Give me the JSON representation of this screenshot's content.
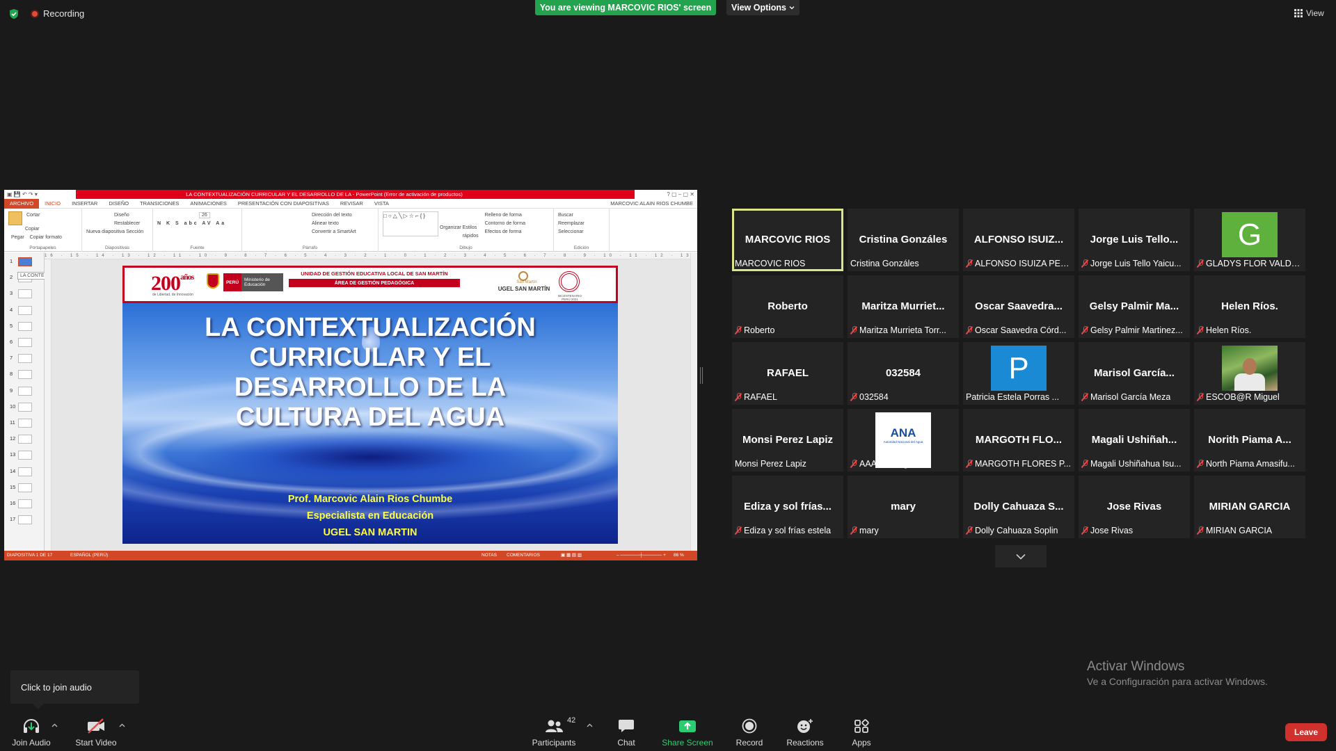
{
  "topbar": {
    "recording_label": "Recording",
    "viewing_banner": "You are viewing MARCOVIC RIOS' screen",
    "view_options_label": "View Options",
    "view_label": "View"
  },
  "ppt": {
    "window_title": "LA CONTEXTUALIZACIÓN CURRICULAR Y EL DESARROLLO DE LA  -  PowerPoint (Error de activación de productos)",
    "tabs": [
      "ARCHIVO",
      "INICIO",
      "INSERTAR",
      "DISEÑO",
      "TRANSICIONES",
      "ANIMACIONES",
      "PRESENTACIÓN CON DIAPOSITIVAS",
      "REVISAR",
      "VISTA"
    ],
    "user": "MARCOVIC ALAIN RIOS CHUMBE",
    "ribbon": {
      "portapapeles": {
        "label": "Portapapeles",
        "pegar": "Pegar",
        "cortar": "Cortar",
        "copiar": "Copiar",
        "copiar_formato": "Copiar formato"
      },
      "diapositivas": {
        "label": "Diapositivas",
        "nueva": "Nueva diapositiva",
        "diseno": "Diseño",
        "restablecer": "Restablecer",
        "seccion": "Sección"
      },
      "fuente": {
        "label": "Fuente",
        "size": "26"
      },
      "parrafo": {
        "label": "Párrafo",
        "direccion": "Dirección del texto",
        "alinear": "Alinear texto",
        "convertir": "Convertir a SmartArt"
      },
      "dibujo": {
        "label": "Dibujo",
        "organizar": "Organizar",
        "estilos": "Estilos rápidos",
        "relleno": "Relleno de forma",
        "contorno": "Contorno de forma",
        "efectos": "Efectos de forma"
      },
      "edicion": {
        "label": "Edición",
        "buscar": "Buscar",
        "reemplazar": "Reemplazar",
        "seleccionar": "Seleccionar"
      }
    },
    "ruler_text": "16 · 15 · 14 · 13 · 12 · 11 · 10 · 9 · 8 · 7 · 6 · 5 · 4 · 3 · 2 · 1 · 0 · 1 · 2 · 3 · 4 · 5 · 6 · 7 · 8 · 9 · 10 · 11 · 12 · 13 · 14 · 15 · 16",
    "thumb_numbers": [
      "1",
      "2",
      "3",
      "4",
      "5",
      "6",
      "7",
      "8",
      "9",
      "10",
      "11",
      "12",
      "13",
      "14",
      "15",
      "16",
      "17"
    ],
    "thumb_tooltip": "LA CONTEXTUALIZACIÓN CURRIC...",
    "status_left": "DIAPOSITIVA 1 DE 17",
    "status_lang": "ESPAÑOL (PERÚ)",
    "status_notas": "NOTAS",
    "status_comentarios": "COMENTARIOS",
    "zoom": "86 %"
  },
  "slide": {
    "logo_text": "200",
    "logo_suffix": "años",
    "logo_sub": "de Libertad, de Innovación",
    "peru": "PERÚ",
    "ministerio": "Ministerio de Educación",
    "unit_title": "UNIDAD DE GESTIÓN EDUCATIVA LOCAL DE SAN MARTÍN",
    "area_title": "ÁREA DE GESTIÓN PEDAGÓGICA",
    "ugel_small": "San Martín",
    "ugel_label": "UGEL SAN MARTÍN",
    "bicent_label": "BICENTENARIO PERÚ 2021",
    "title_lines": [
      "LA CONTEXTUALIZACIÓN",
      "CURRICULAR Y EL",
      "DESARROLLO DE LA",
      "CULTURA DEL AGUA"
    ],
    "author_lines": [
      "Prof. Marcovic Alain Rios Chumbe",
      "Especialista en Educación",
      "UGEL SAN MARTIN"
    ]
  },
  "participants": [
    {
      "big": "MARCOVIC RIOS",
      "label": "MARCOVIC RIOS",
      "muted": false,
      "active": true
    },
    {
      "big": "Cristina Gonzáles",
      "label": "Cristina Gonzáles",
      "muted": false
    },
    {
      "big": "ALFONSO ISUIZ...",
      "label": "ALFONSO ISUIZA PER...",
      "muted": true
    },
    {
      "big": "Jorge Luis Tello...",
      "label": "Jorge Luis Tello Yaicu...",
      "muted": true
    },
    {
      "big": "",
      "label": "GLADYS FLOR VALDE...",
      "muted": true,
      "avatar_letter": "G",
      "avatar_color": "#5db13c"
    },
    {
      "big": "Roberto",
      "label": "Roberto",
      "muted": true
    },
    {
      "big": "Maritza Murriet...",
      "label": "Maritza Murrieta Torr...",
      "muted": true
    },
    {
      "big": "Oscar Saavedra...",
      "label": "Oscar Saavedra Córd...",
      "muted": true
    },
    {
      "big": "Gelsy Palmir Ma...",
      "label": "Gelsy Palmir Martinez...",
      "muted": true
    },
    {
      "big": "Helen Ríos.",
      "label": "Helen Ríos.",
      "muted": true
    },
    {
      "big": "RAFAEL",
      "label": "RAFAEL",
      "muted": true
    },
    {
      "big": "032584",
      "label": "032584",
      "muted": true
    },
    {
      "big": "",
      "label": "Patricia Estela Porras ...",
      "muted": false,
      "avatar_letter": "P",
      "avatar_color": "#1a8ad4"
    },
    {
      "big": "Marisol García...",
      "label": "Marisol García Meza",
      "muted": true
    },
    {
      "big": "",
      "label": "ESCOB@R Miguel",
      "muted": true,
      "avatar_photo": true
    },
    {
      "big": "Monsi Perez Lapiz",
      "label": "Monsi Perez Lapiz",
      "muted": false
    },
    {
      "big": "",
      "label": "AAA Huallaga",
      "muted": true,
      "avatar_logo": "ANA",
      "avatar_logo_sub": "Autoridad Nacional del Agua"
    },
    {
      "big": "MARGOTH FLO...",
      "label": "MARGOTH FLORES P...",
      "muted": true
    },
    {
      "big": "Magali Ushiñah...",
      "label": "Magali Ushiñahua Isu...",
      "muted": true
    },
    {
      "big": "Norith Piama A...",
      "label": "North Piama Amasifu...",
      "muted": true
    },
    {
      "big": "Ediza y sol frías...",
      "label": "Ediza y sol frías estela",
      "muted": true
    },
    {
      "big": "mary",
      "label": "mary",
      "muted": true
    },
    {
      "big": "Dolly Cahuaza S...",
      "label": "Dolly Cahuaza Soplin",
      "muted": true
    },
    {
      "big": "Jose Rivas",
      "label": "Jose Rivas",
      "muted": true
    },
    {
      "big": "MIRIAN GARCIA",
      "label": "MIRIAN GARCIA",
      "muted": true
    }
  ],
  "watermark": {
    "line1": "Activar Windows",
    "line2": "Ve a Configuración para activar Windows."
  },
  "join_tip": "Click to join audio",
  "toolbar": {
    "join_audio": "Join Audio",
    "start_video": "Start Video",
    "participants": "Participants",
    "participant_count": "42",
    "chat": "Chat",
    "share_screen": "Share Screen",
    "record": "Record",
    "reactions": "Reactions",
    "apps": "Apps",
    "leave": "Leave"
  },
  "colors": {
    "accent_green": "#23a34e",
    "active_speaker": "#dbe58a",
    "leave_red": "#d0312d",
    "ppt_red": "#d24726"
  }
}
